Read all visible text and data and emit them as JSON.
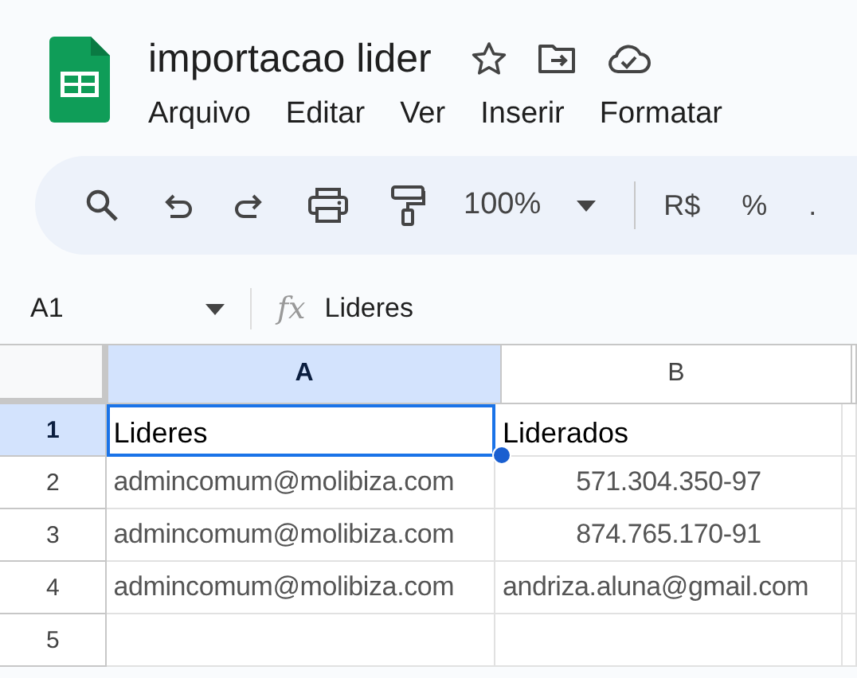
{
  "document": {
    "title": "importacao lider"
  },
  "menu": [
    "Arquivo",
    "Editar",
    "Ver",
    "Inserir",
    "Formatar"
  ],
  "toolbar": {
    "zoom": "100%",
    "currency": "R$",
    "percent": "%",
    "decimal": "."
  },
  "formula_bar": {
    "cell_ref": "A1",
    "function_label": "fx",
    "value": "Lideres"
  },
  "sheet": {
    "columns": [
      {
        "label": "A",
        "selected": true
      },
      {
        "label": "B",
        "selected": false
      }
    ],
    "rows": [
      {
        "label": "1",
        "selected": true,
        "cells": [
          {
            "text": "Lideres",
            "kind": "title",
            "selected": true
          },
          {
            "text": "Liderados",
            "kind": "title",
            "selected": false
          }
        ]
      },
      {
        "label": "2",
        "selected": false,
        "cells": [
          {
            "text": "admincomum@molibiza.com",
            "kind": "text",
            "selected": false
          },
          {
            "text": "571.304.350-97",
            "kind": "number",
            "selected": false
          }
        ]
      },
      {
        "label": "3",
        "selected": false,
        "cells": [
          {
            "text": "admincomum@molibiza.com",
            "kind": "text",
            "selected": false
          },
          {
            "text": "874.765.170-91",
            "kind": "number",
            "selected": false
          }
        ]
      },
      {
        "label": "4",
        "selected": false,
        "cells": [
          {
            "text": "admincomum@molibiza.com",
            "kind": "text",
            "selected": false
          },
          {
            "text": "andriza.aluna@gmail.com",
            "kind": "text",
            "selected": false
          }
        ]
      },
      {
        "label": "5",
        "selected": false
      }
    ]
  }
}
